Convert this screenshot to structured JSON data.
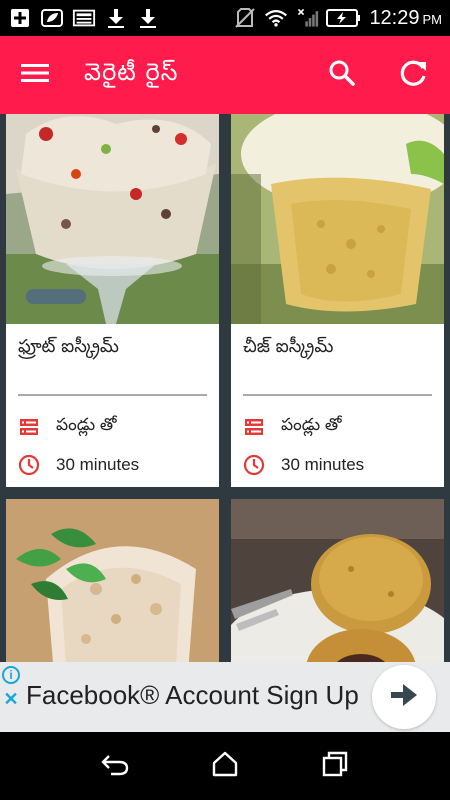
{
  "status_bar": {
    "time": "12:29",
    "ampm": "PM",
    "icons": [
      "add-box-icon",
      "leaf-icon",
      "image-icon",
      "download-icon",
      "download-icon",
      "no-sim-icon",
      "wifi-icon",
      "signal-icon",
      "battery-charging-icon"
    ]
  },
  "appbar": {
    "title": "వెరైటీ రైస్",
    "color": "#ff1b4c",
    "menu_icon": "hamburger-menu-icon",
    "search_icon": "search-icon",
    "refresh_icon": "refresh-icon"
  },
  "recipes": [
    {
      "title": "ఫ్రూట్ ఐస్క్రీమ్",
      "category": "పండ్లు తో",
      "time": "30 minutes",
      "image": "fruit-ice-cream-photo"
    },
    {
      "title": "చీజ్ ఐస్క్రీమ్",
      "category": "పండ్లు తో",
      "time": "30 minutes",
      "image": "cheese-ice-cream-photo"
    },
    {
      "title": "",
      "category": "",
      "time": "",
      "image": "coconut-dessert-photo"
    },
    {
      "title": "",
      "category": "",
      "time": "",
      "image": "fried-ball-dessert-photo"
    }
  ],
  "ad": {
    "text": "Facebook® Account Sign Up",
    "info_icon": "info-icon",
    "close_icon": "close-icon",
    "arrow_icon": "arrow-right-icon"
  },
  "nav_bar": {
    "icons": [
      "back-icon",
      "home-icon",
      "recents-icon"
    ]
  }
}
